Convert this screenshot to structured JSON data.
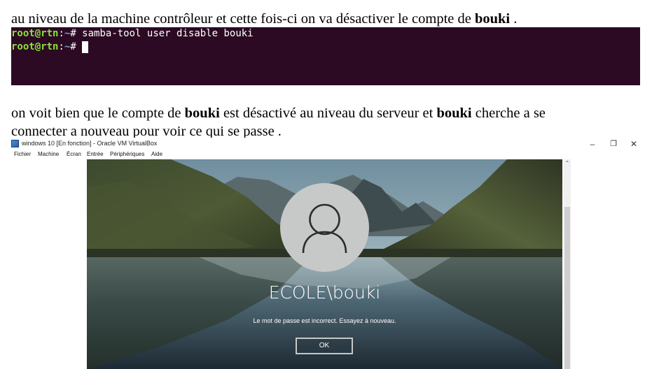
{
  "doc": {
    "p1": {
      "before": "au niveau de la machine contrôleur et cette fois-ci on va désactiver le compte de ",
      "bold": "bouki",
      "after": "  ."
    },
    "p2": {
      "a": "on voit bien que le compte de ",
      "b": "bouki",
      "c": " est désactivé au niveau du serveur et ",
      "d": "bouki",
      "e": " cherche a se"
    },
    "p3": "connecter a nouveau pour voir ce qui se passe ."
  },
  "terminal": {
    "prompt_user": "root@rtn",
    "prompt_sep": ":",
    "prompt_path": "~",
    "prompt_end": "# ",
    "command": "samba-tool user disable bouki"
  },
  "vbox": {
    "title": "windows 10 [En fonction] - Oracle VM VirtualBox",
    "menu": [
      "Fichier",
      "Machine",
      "Écran",
      "Entrée",
      "Périphériques",
      "Aide"
    ],
    "controls": {
      "minimize": "–",
      "restore": "❐",
      "close": "✕"
    }
  },
  "login": {
    "username": "ECOLE\\bouki",
    "message": "Le mot de passe est incorrect. Essayez à nouveau.",
    "ok": "OK"
  },
  "icons": [
    "virtualbox-logo-icon",
    "user-avatar-icon",
    "scroll-up-icon"
  ]
}
